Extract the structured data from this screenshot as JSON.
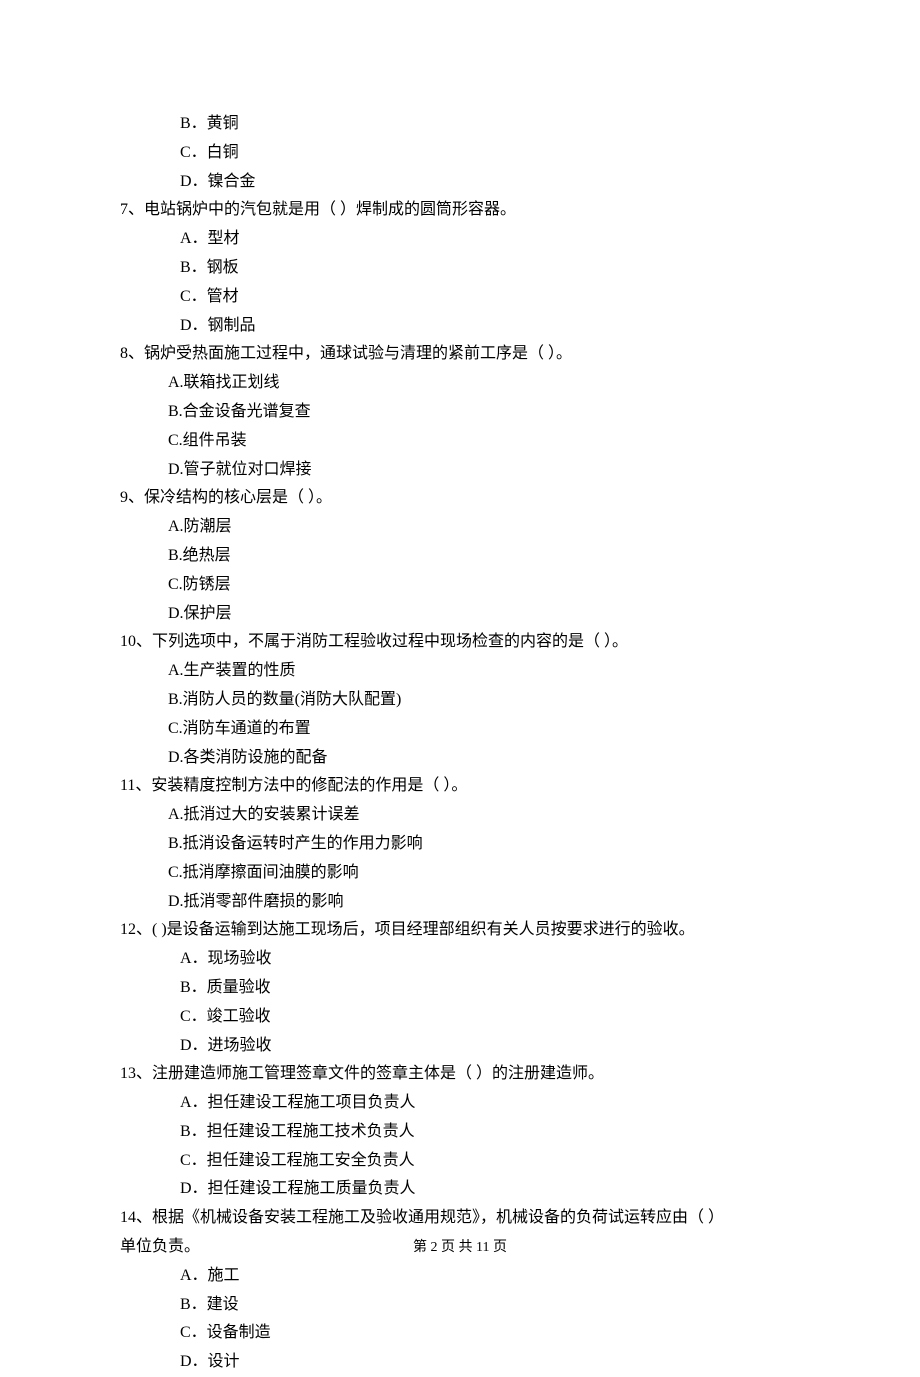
{
  "prev_options": {
    "b": "B．黄铜",
    "c": "C．白铜",
    "d": "D．镍合金"
  },
  "q7": {
    "text": "7、电站锅炉中的汽包就是用（    ）焊制成的圆筒形容器。",
    "a": "A．型材",
    "b": "B．钢板",
    "c": "C．管材",
    "d": "D．钢制品"
  },
  "q8": {
    "text": "8、锅炉受热面施工过程中，通球试验与清理的紧前工序是（   ）。",
    "a": "A.联箱找正划线",
    "b": "B.合金设备光谱复查",
    "c": "C.组件吊装",
    "d": "D.管子就位对口焊接"
  },
  "q9": {
    "text": "9、保冷结构的核心层是（   ）。",
    "a": "A.防潮层",
    "b": "B.绝热层",
    "c": "C.防锈层",
    "d": "D.保护层"
  },
  "q10": {
    "text": "10、下列选项中，不属于消防工程验收过程中现场检查的内容的是（   ）。",
    "a": "A.生产装置的性质",
    "b": "B.消防人员的数量(消防大队配置)",
    "c": "C.消防车通道的布置",
    "d": "D.各类消防设施的配备"
  },
  "q11": {
    "text": "11、安装精度控制方法中的修配法的作用是（   ）。",
    "a": "A.抵消过大的安装累计误差",
    "b": "B.抵消设备运转时产生的作用力影响",
    "c": "C.抵消摩擦面间油膜的影响",
    "d": "D.抵消零部件磨损的影响"
  },
  "q12": {
    "text": "12、(    )是设备运输到达施工现场后，项目经理部组织有关人员按要求进行的验收。",
    "a": "A．现场验收",
    "b": "B．质量验收",
    "c": "C．竣工验收",
    "d": "D．进场验收"
  },
  "q13": {
    "text": "13、注册建造师施工管理签章文件的签章主体是（   ）的注册建造师。",
    "a": "A．担任建设工程施工项目负责人",
    "b": "B．担任建设工程施工技术负责人",
    "c": "C．担任建设工程施工安全负责人",
    "d": "D．担任建设工程施工质量负责人"
  },
  "q14": {
    "text": "14、根据《机械设备安装工程施工及验收通用规范》，机械设备的负荷试运转应由（   ）",
    "text2": "单位负责。",
    "a": "A．施工",
    "b": "B．建设",
    "c": "C．设备制造",
    "d": "D．设计"
  },
  "footer": "第 2 页 共 11 页"
}
